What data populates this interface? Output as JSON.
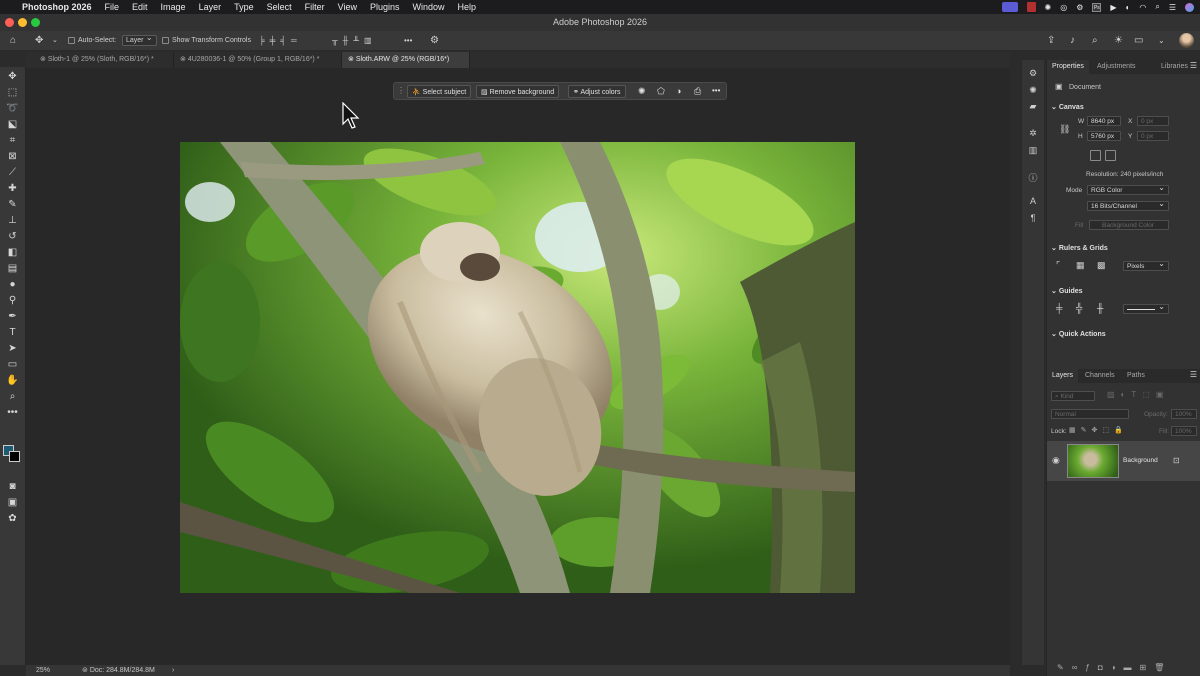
{
  "menubar": {
    "apple_icon": "apple-logo-icon",
    "app_name": "Photoshop 2026",
    "items": [
      "File",
      "Edit",
      "Image",
      "Layer",
      "Type",
      "Select",
      "Filter",
      "View",
      "Plugins",
      "Window",
      "Help"
    ],
    "status_icons": [
      "screen-share-icon",
      "record-icon",
      "brightness-icon",
      "focus-icon",
      "settings-icon",
      "app-icon",
      "play-icon",
      "circle-icon",
      "wifi-icon",
      "search-icon",
      "control-center-icon",
      "siri-icon"
    ]
  },
  "titlebar": {
    "title": "Adobe Photoshop 2026"
  },
  "options_bar": {
    "auto_select_label": "Auto-Select:",
    "auto_select_value": "Layer",
    "show_transform_label": "Show Transform Controls",
    "more_label": "•••"
  },
  "tabs": [
    {
      "label": "Sloth-1 @ 25% (Sloth, RGB/16*) *"
    },
    {
      "label": "4U280036-1 @ 50% (Group 1, RGB/16*) *"
    },
    {
      "label": "Sloth.ARW @ 25% (RGB/16*)"
    }
  ],
  "taskbar": {
    "select_subject": "Select subject",
    "remove_background": "Remove background",
    "adjust_colors": "Adjust colors",
    "more": "•••"
  },
  "status": {
    "zoom": "25%",
    "doc": "Doc: 284.8M/284.8M"
  },
  "properties": {
    "tabs": [
      "Properties",
      "Adjustments",
      "Libraries"
    ],
    "document_label": "Document",
    "canvas_section": "Canvas",
    "width_label": "W",
    "width_value": "8640 px",
    "height_label": "H",
    "height_value": "5760 px",
    "x_label": "X",
    "x_placeholder": "0 px",
    "y_label": "Y",
    "y_placeholder": "0 px",
    "resolution": "Resolution: 240 pixels/inch",
    "mode_label": "Mode",
    "mode_value": "RGB Color",
    "bits_value": "16 Bits/Channel",
    "fill_label": "Fill",
    "fill_value": "Background Color",
    "rulers_section": "Rulers & Grids",
    "units_value": "Pixels",
    "guides_section": "Guides",
    "quick_actions_section": "Quick Actions"
  },
  "layers": {
    "tabs": [
      "Layers",
      "Channels",
      "Paths"
    ],
    "kind_placeholder": "Kind",
    "blend_mode": "Normal",
    "opacity_label": "Opacity:",
    "opacity_value": "100%",
    "lock_label": "Lock:",
    "fill_label": "Fill:",
    "fill_value": "100%",
    "items": [
      {
        "name": "Background"
      }
    ]
  },
  "colors": {
    "foreground": "#1d5a73",
    "background": "#000000",
    "accent": "#4a7fd8"
  }
}
